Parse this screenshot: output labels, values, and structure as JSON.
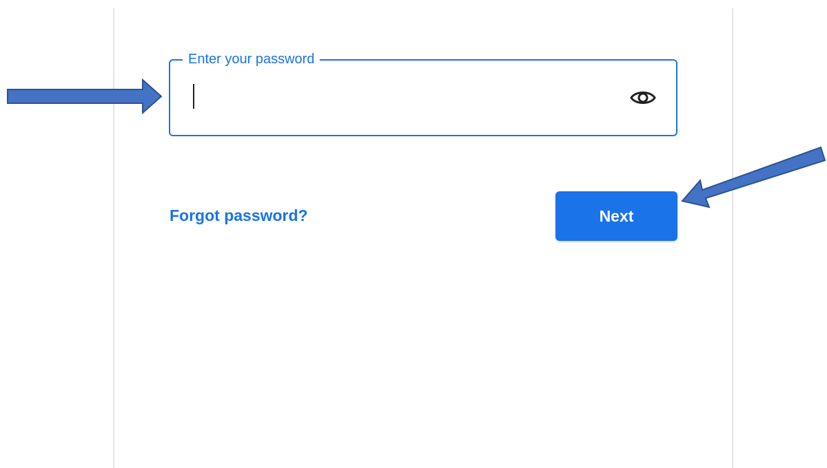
{
  "password_form": {
    "field_label": "Enter your password",
    "field_value": "",
    "show_password_icon": "eye-icon",
    "forgot_link": "Forgot password?",
    "next_label": "Next"
  },
  "annotations": {
    "arrow_color": "#4472c4",
    "arrow_outline": "#2f528f"
  },
  "colors": {
    "accent": "#1a73e8",
    "card_border": "#e3e3e3",
    "text": "#202124"
  }
}
